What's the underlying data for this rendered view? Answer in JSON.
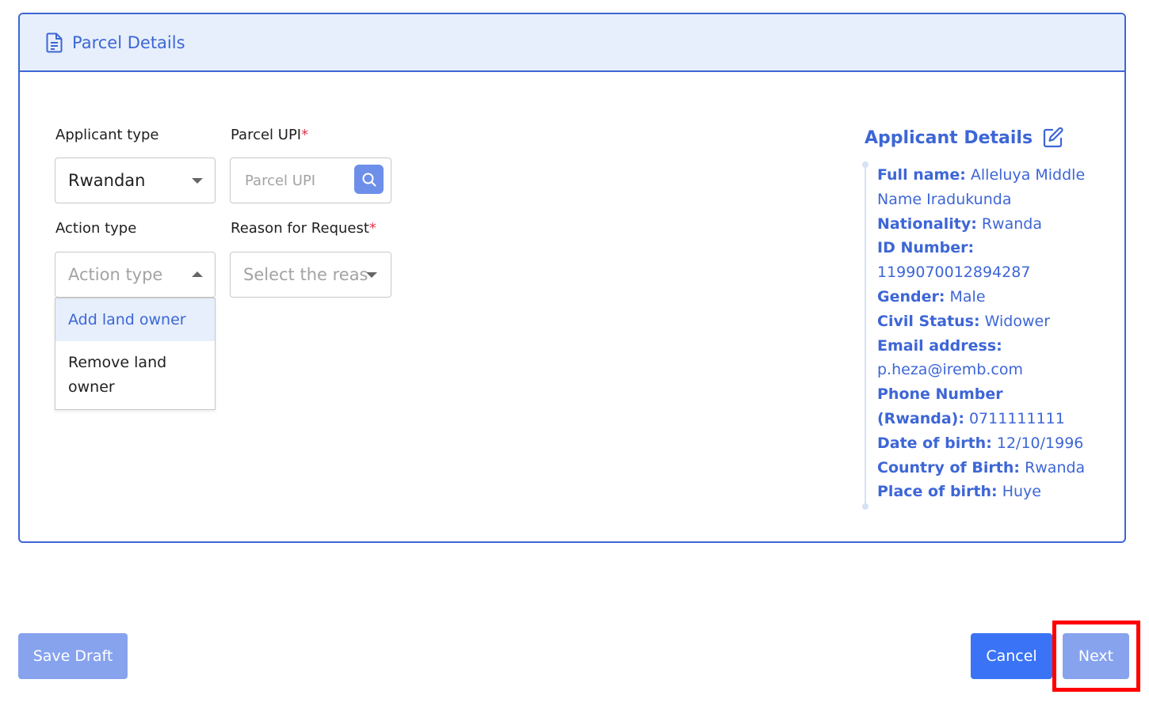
{
  "header": {
    "title": "Parcel Details",
    "icon": "document-icon"
  },
  "form": {
    "applicant_type": {
      "label": "Applicant type",
      "value": "Rwandan"
    },
    "parcel_upi": {
      "label": "Parcel UPI",
      "required_mark": "*",
      "placeholder": "Parcel UPI"
    },
    "action_type": {
      "label": "Action type",
      "placeholder": "Action type",
      "options": [
        "Add land owner",
        "Remove land owner"
      ]
    },
    "reason": {
      "label": "Reason for Request",
      "required_mark": "*",
      "placeholder": "Select the reas"
    }
  },
  "applicant": {
    "heading": "Applicant Details",
    "rows": [
      {
        "label": "Full name:",
        "value": "Alleluya Middle Name Iradukunda"
      },
      {
        "label": "Nationality:",
        "value": "Rwanda"
      },
      {
        "label": "ID Number:",
        "value": "1199070012894287"
      },
      {
        "label": "Gender:",
        "value": "Male"
      },
      {
        "label": "Civil Status:",
        "value": "Widower"
      },
      {
        "label": "Email address:",
        "value": "p.heza@iremb.com"
      },
      {
        "label": "Phone Number (Rwanda):",
        "value": "0711111111"
      },
      {
        "label": "Date of birth:",
        "value": "12/10/1996"
      },
      {
        "label": "Country of Birth:",
        "value": "Rwanda"
      },
      {
        "label": "Place of birth:",
        "value": "Huye"
      }
    ]
  },
  "footer": {
    "save_draft": "Save Draft",
    "cancel": "Cancel",
    "next": "Next"
  },
  "colors": {
    "accent": "#3d66d6",
    "header_bg": "#e6effb",
    "primary_button": "#3a73f5",
    "disabled_button": "#87a3ee",
    "required": "#e0344a",
    "highlight": "#ff0000"
  }
}
